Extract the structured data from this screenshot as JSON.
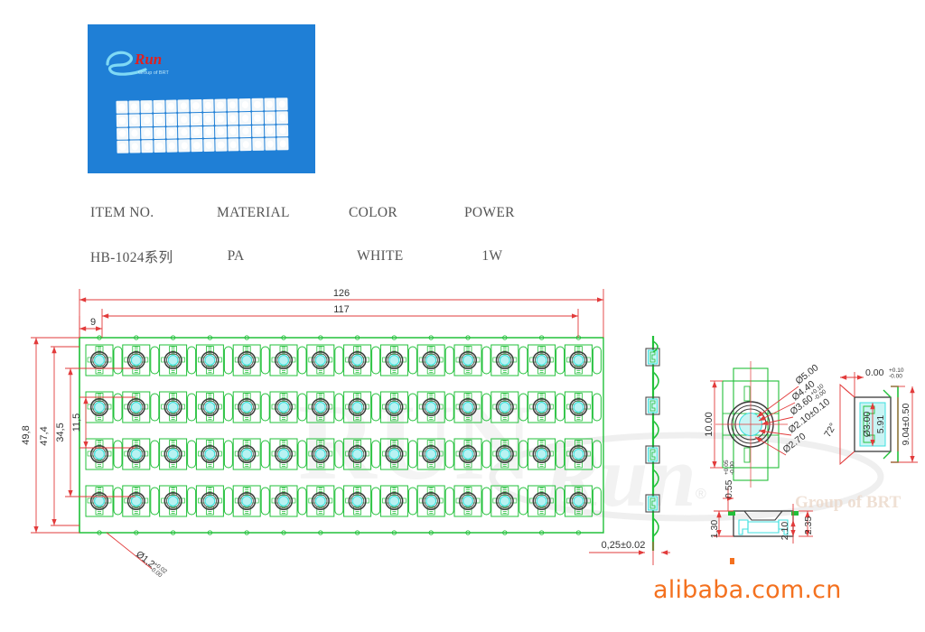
{
  "photo": {
    "brand_logo": "rui-e-logo",
    "background_color": "#1f7fd6",
    "array_rows": 4,
    "array_cols": 14
  },
  "spec_table": {
    "headers": [
      "ITEM NO.",
      "MATERIAL",
      "COLOR",
      "POWER"
    ],
    "values": [
      "HB-1024系列",
      "PA",
      "WHITE",
      "1W"
    ]
  },
  "drawing": {
    "top_dims": {
      "overall": "126",
      "inner": "117",
      "edge": "9"
    },
    "left_dims": {
      "overall": "49,8",
      "d2": "47,4",
      "d3": "34,5",
      "d4": "11,5"
    },
    "hole_note": "Ø1,2",
    "hole_tol_upper": "+0.02",
    "hole_tol_lower": "-0.00",
    "thickness": "0,25±0.02",
    "grid": {
      "rows": 4,
      "cols": 14
    },
    "side_view_modules": 4,
    "detail_top": {
      "height": "10.00",
      "d_outer": "Ø5.00",
      "d_2": "Ø4.40",
      "d_3": "Ø3.60",
      "d_3_tol_upper": "+0.10",
      "d_3_tol_lower": "-0.00",
      "d_4": "Ø2.10±0.10",
      "d_5": "Ø2.70",
      "angle": "72°",
      "datum": "0.00",
      "datum_tol_upper": "+0.10",
      "datum_tol_lower": "-0.00",
      "bore": "Ø3.00",
      "depth": "5.91",
      "length": "9.04±0.50"
    },
    "detail_bottom": {
      "h1": "0.55",
      "h1_tol_upper": "+0.05",
      "h1_tol_lower": "-0.00",
      "w1": "1.30",
      "w2": "2.10",
      "w3": "2.35"
    },
    "watermark_main": "RUN",
    "watermark_brand": "Run",
    "watermark_group": "Group of BRT",
    "watermark_reg": "®"
  },
  "footer": {
    "url": "alibaba.com.cn"
  },
  "colors": {
    "drawing_green": "#22c03a",
    "dimension_red": "#e23b3b",
    "ring_dark": "#3a3a3a",
    "lens_cyan": "#3fe0e0",
    "photo_blue": "#1f7fd6",
    "alibaba_orange": "#f4711f"
  }
}
